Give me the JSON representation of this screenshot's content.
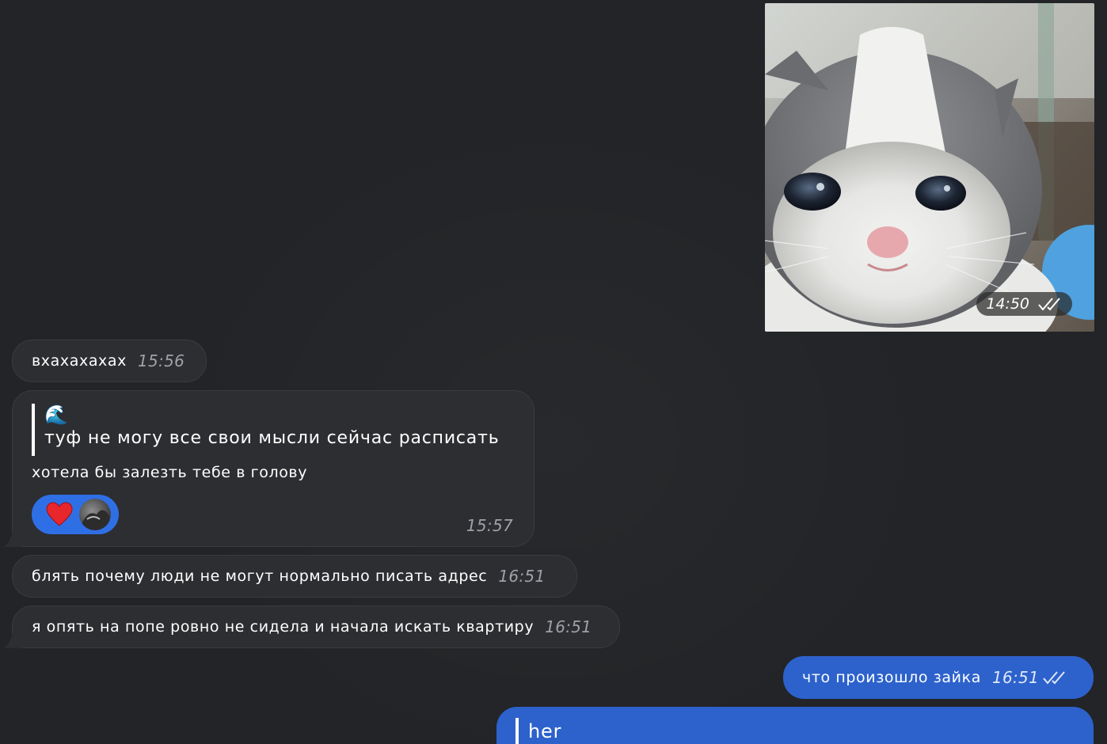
{
  "media_message": {
    "image_alt": "kitten",
    "time": "14:50",
    "status_icon": "double-check-icon"
  },
  "messages": [
    {
      "direction": "in",
      "text": "вхахахахах",
      "time": "15:56"
    },
    {
      "direction": "in",
      "quote_emoji": "🌊",
      "quote_text": "туф не могу все свои мысли сейчас расписать",
      "text": "хотела бы залезть тебе в голову",
      "reactions": [
        "heart-reaction",
        "reactor-avatar"
      ],
      "time": "15:57"
    },
    {
      "direction": "in",
      "text": "блять почему люди не могут нормально писать адрес",
      "time": "16:51"
    },
    {
      "direction": "in",
      "text": "я опять на попе ровно не сидела и начала искать квартиру",
      "time": "16:51"
    },
    {
      "direction": "out",
      "text": "что произошло зайка",
      "time": "16:51",
      "status_icon": "double-check-icon"
    },
    {
      "direction": "out",
      "quote_text": "her"
    }
  ],
  "colors": {
    "background": "#222427",
    "incoming_bubble": "#2d2e31",
    "outgoing_bubble": "#2d62cc",
    "reaction_pill": "#2f6fe6"
  }
}
